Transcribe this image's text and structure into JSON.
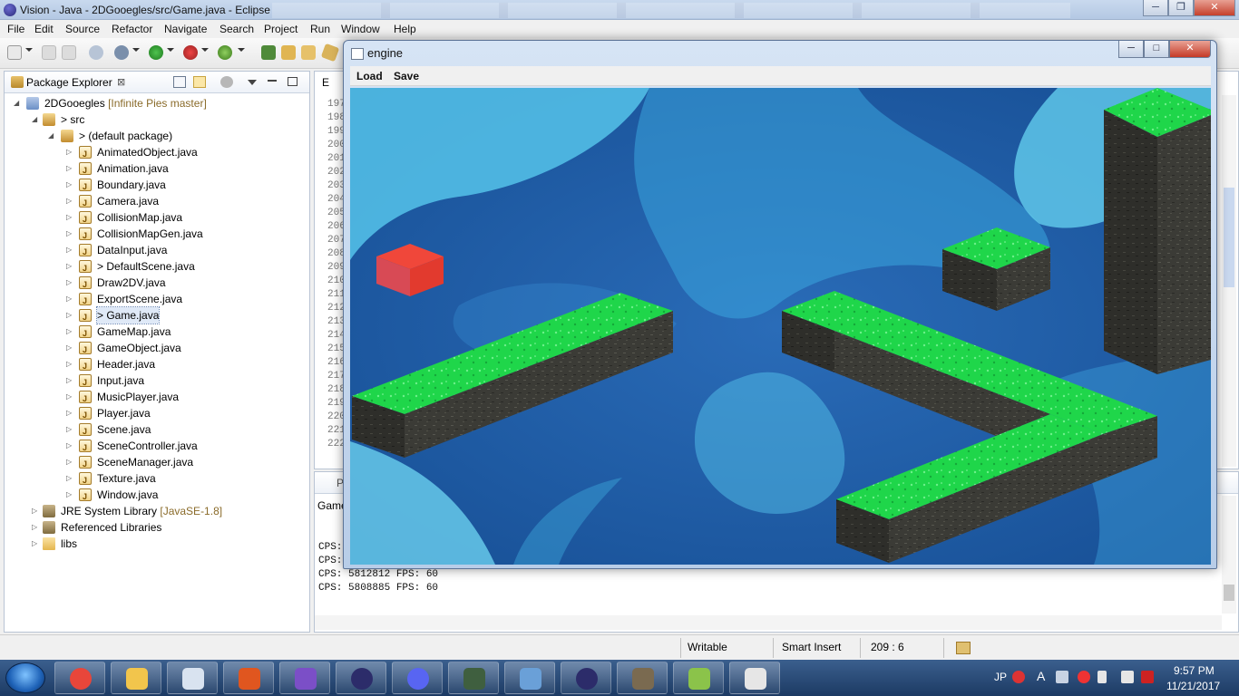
{
  "window": {
    "title": "Vision - Java - 2DGooegles/src/Game.java - Eclipse",
    "controls": {
      "minimize": "─",
      "maximize": "❐",
      "close": "✕"
    }
  },
  "menubar": [
    "File",
    "Edit",
    "Source",
    "Refactor",
    "Navigate",
    "Search",
    "Project",
    "Run",
    "Window",
    "Help"
  ],
  "package_explorer": {
    "tab_label": "Package Explorer",
    "tab_close": "⊠",
    "project": {
      "name": "2DGooegles",
      "repo": "[Infinite Pies master]"
    },
    "src": "> src",
    "default_package": "> (default package)",
    "files": [
      "AnimatedObject.java",
      "Animation.java",
      "Boundary.java",
      "Camera.java",
      "CollisionMap.java",
      "CollisionMapGen.java",
      "DataInput.java",
      "> DefaultScene.java",
      "Draw2DV.java",
      "ExportScene.java",
      "> Game.java",
      "GameMap.java",
      "GameObject.java",
      "Header.java",
      "Input.java",
      "MusicPlayer.java",
      "Player.java",
      "Scene.java",
      "SceneController.java",
      "SceneManager.java",
      "Texture.java",
      "Window.java"
    ],
    "selected_file": "> Game.java",
    "jre": {
      "name": "JRE System Library",
      "version": "[JavaSE-1.8]"
    },
    "referenced_libraries": "Referenced Libraries",
    "libs": "libs"
  },
  "editor": {
    "tab_partial": "E",
    "line_numbers": [
      "197",
      "198",
      "199",
      "200",
      "201",
      "202",
      "203",
      "204",
      "205",
      "206",
      "207",
      "208",
      "209",
      "210",
      "211",
      "212",
      "213",
      "214",
      "215",
      "216",
      "217",
      "218",
      "219",
      "220",
      "221",
      "222"
    ]
  },
  "console": {
    "tab_partial": "P",
    "description_partial": "Game",
    "lines": [
      "CPS: ",
      "CPS: ",
      "CPS: 5812812 FPS: 60",
      "CPS: 5808885 FPS: 60"
    ]
  },
  "statusbar": {
    "writable": "Writable",
    "insert_mode": "Smart Insert",
    "position": "209 : 6"
  },
  "game_window": {
    "title": "engine",
    "menu": [
      "Load",
      "Save"
    ],
    "controls": {
      "minimize": "─",
      "maximize": "□",
      "close": "✕"
    },
    "colors": {
      "platform_top": "#1fd64a",
      "platform_side": "#3b3b36",
      "player_cube": "#e23a2e",
      "background": "#1b5fa8"
    }
  },
  "taskbar": {
    "apps": [
      "chrome",
      "file-explorer",
      "paint-tools",
      "mega",
      "visual-studio",
      "eclipse",
      "discord",
      "terminal",
      "photos",
      "eclipse-2",
      "gimp",
      "android-studio",
      "java"
    ],
    "lang": "JP",
    "ime": "A",
    "time": "9:57 PM",
    "date": "11/21/2017"
  }
}
